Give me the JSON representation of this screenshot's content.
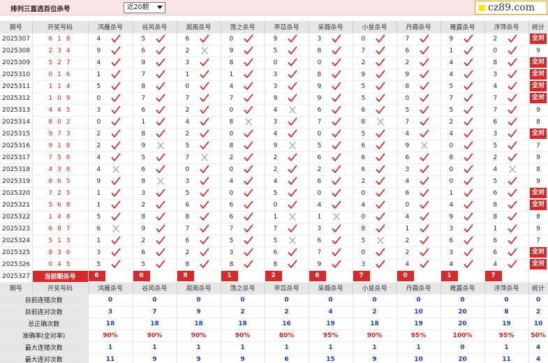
{
  "header": {
    "title": "排列三直选百位杀号",
    "period_selected": "近20期",
    "logo_text": "cz89.com"
  },
  "columns": [
    "期号",
    "开奖号码",
    "鸿雁杀号",
    "谷风杀号",
    "周南杀号",
    "荡之杀号",
    "芣苡杀号",
    "采薇杀号",
    "小旻杀号",
    "丹霞杀号",
    "雍露杀号",
    "浮萍杀号",
    "统计"
  ],
  "rows": [
    {
      "period": "2025307",
      "draw": "618",
      "v": [
        [
          4,
          1
        ],
        [
          5,
          1
        ],
        [
          6,
          1
        ],
        [
          0,
          1
        ],
        [
          9,
          1
        ],
        [
          3,
          1
        ],
        [
          0,
          1
        ],
        [
          7,
          1
        ],
        [
          9,
          1
        ],
        [
          2,
          1
        ]
      ],
      "stat": "全对"
    },
    {
      "period": "2025308",
      "draw": "234",
      "v": [
        [
          9,
          1
        ],
        [
          6,
          1
        ],
        [
          2,
          0
        ],
        [
          9,
          1
        ],
        [
          5,
          1
        ],
        [
          8,
          1
        ],
        [
          7,
          1
        ],
        [
          6,
          1
        ],
        [
          1,
          1
        ],
        [
          0,
          1
        ]
      ],
      "stat": "9"
    },
    {
      "period": "2025309",
      "draw": "527",
      "v": [
        [
          4,
          1
        ],
        [
          9,
          1
        ],
        [
          3,
          1
        ],
        [
          8,
          1
        ],
        [
          0,
          1
        ],
        [
          0,
          1
        ],
        [
          2,
          1
        ],
        [
          2,
          1
        ],
        [
          4,
          1
        ],
        [
          8,
          1
        ]
      ],
      "stat": "全对"
    },
    {
      "period": "2025310",
      "draw": "016",
      "v": [
        [
          1,
          1
        ],
        [
          7,
          1
        ],
        [
          1,
          1
        ],
        [
          1,
          1
        ],
        [
          3,
          1
        ],
        [
          8,
          1
        ],
        [
          9,
          1
        ],
        [
          9,
          1
        ],
        [
          4,
          1
        ],
        [
          3,
          1
        ]
      ],
      "stat": "全对"
    },
    {
      "period": "2025311",
      "draw": "114",
      "v": [
        [
          5,
          1
        ],
        [
          8,
          1
        ],
        [
          0,
          1
        ],
        [
          4,
          1
        ],
        [
          3,
          1
        ],
        [
          9,
          1
        ],
        [
          5,
          1
        ],
        [
          8,
          1
        ],
        [
          5,
          1
        ],
        [
          4,
          1
        ]
      ],
      "stat": "全对"
    },
    {
      "period": "2025312",
      "draw": "109",
      "v": [
        [
          0,
          1
        ],
        [
          7,
          1
        ],
        [
          7,
          1
        ],
        [
          7,
          1
        ],
        [
          9,
          1
        ],
        [
          9,
          1
        ],
        [
          5,
          1
        ],
        [
          0,
          1
        ],
        [
          7,
          1
        ],
        [
          7,
          1
        ]
      ],
      "stat": "全对"
    },
    {
      "period": "2025313",
      "draw": "445",
      "v": [
        [
          3,
          1
        ],
        [
          6,
          1
        ],
        [
          2,
          1
        ],
        [
          0,
          1
        ],
        [
          4,
          0
        ],
        [
          6,
          1
        ],
        [
          6,
          1
        ],
        [
          5,
          1
        ],
        [
          5,
          1
        ],
        [
          7,
          1
        ]
      ],
      "stat": "9"
    },
    {
      "period": "2025314",
      "draw": "802",
      "v": [
        [
          0,
          1
        ],
        [
          1,
          1
        ],
        [
          4,
          1
        ],
        [
          8,
          0
        ],
        [
          3,
          1
        ],
        [
          7,
          1
        ],
        [
          8,
          0
        ],
        [
          7,
          1
        ],
        [
          2,
          1
        ],
        [
          6,
          1
        ]
      ],
      "stat": "8"
    },
    {
      "period": "2025315",
      "draw": "973",
      "v": [
        [
          2,
          1
        ],
        [
          8,
          1
        ],
        [
          2,
          1
        ],
        [
          0,
          1
        ],
        [
          4,
          1
        ],
        [
          0,
          1
        ],
        [
          5,
          1
        ],
        [
          4,
          1
        ],
        [
          4,
          1
        ],
        [
          3,
          1
        ]
      ],
      "stat": "全对"
    },
    {
      "period": "2025316",
      "draw": "918",
      "v": [
        [
          2,
          1
        ],
        [
          9,
          0
        ],
        [
          5,
          1
        ],
        [
          8,
          1
        ],
        [
          9,
          0
        ],
        [
          5,
          1
        ],
        [
          6,
          1
        ],
        [
          9,
          0
        ],
        [
          0,
          1
        ],
        [
          5,
          1
        ]
      ],
      "stat": "7"
    },
    {
      "period": "2025317",
      "draw": "756",
      "v": [
        [
          4,
          1
        ],
        [
          5,
          1
        ],
        [
          7,
          0
        ],
        [
          2,
          1
        ],
        [
          2,
          1
        ],
        [
          6,
          1
        ],
        [
          6,
          1
        ],
        [
          6,
          1
        ],
        [
          8,
          1
        ],
        [
          2,
          1
        ]
      ],
      "stat": "9"
    },
    {
      "period": "2025318",
      "draw": "438",
      "v": [
        [
          4,
          0
        ],
        [
          6,
          1
        ],
        [
          0,
          1
        ],
        [
          0,
          1
        ],
        [
          2,
          1
        ],
        [
          2,
          1
        ],
        [
          6,
          1
        ],
        [
          3,
          1
        ],
        [
          0,
          1
        ],
        [
          4,
          0
        ]
      ],
      "stat": "8"
    },
    {
      "period": "2025319",
      "draw": "865",
      "v": [
        [
          9,
          1
        ],
        [
          8,
          0
        ],
        [
          3,
          1
        ],
        [
          4,
          1
        ],
        [
          4,
          1
        ],
        [
          6,
          1
        ],
        [
          2,
          1
        ],
        [
          4,
          1
        ],
        [
          0,
          1
        ],
        [
          5,
          1
        ]
      ],
      "stat": "9"
    },
    {
      "period": "2025320",
      "draw": "725",
      "v": [
        [
          1,
          1
        ],
        [
          3,
          1
        ],
        [
          5,
          1
        ],
        [
          0,
          1
        ],
        [
          5,
          1
        ],
        [
          0,
          1
        ],
        [
          0,
          1
        ],
        [
          6,
          1
        ],
        [
          1,
          1
        ],
        [
          6,
          1
        ]
      ],
      "stat": "全对"
    },
    {
      "period": "2025321",
      "draw": "568",
      "v": [
        [
          1,
          1
        ],
        [
          2,
          1
        ],
        [
          6,
          1
        ],
        [
          6,
          1
        ],
        [
          0,
          1
        ],
        [
          4,
          1
        ],
        [
          4,
          1
        ],
        [
          0,
          1
        ],
        [
          4,
          1
        ],
        [
          8,
          1
        ]
      ],
      "stat": "全对"
    },
    {
      "period": "2025322",
      "draw": "148",
      "v": [
        [
          5,
          1
        ],
        [
          8,
          1
        ],
        [
          8,
          1
        ],
        [
          6,
          1
        ],
        [
          1,
          0
        ],
        [
          1,
          0
        ],
        [
          0,
          1
        ],
        [
          4,
          1
        ],
        [
          9,
          1
        ],
        [
          8,
          1
        ]
      ],
      "stat": "8"
    },
    {
      "period": "2025323",
      "draw": "687",
      "v": [
        [
          6,
          0
        ],
        [
          9,
          1
        ],
        [
          7,
          1
        ],
        [
          7,
          1
        ],
        [
          7,
          1
        ],
        [
          3,
          1
        ],
        [
          8,
          1
        ],
        [
          1,
          1
        ],
        [
          3,
          1
        ],
        [
          1,
          1
        ]
      ],
      "stat": "9"
    },
    {
      "period": "2025324",
      "draw": "513",
      "v": [
        [
          1,
          1
        ],
        [
          2,
          1
        ],
        [
          6,
          1
        ],
        [
          5,
          1
        ],
        [
          5,
          0
        ],
        [
          6,
          1
        ],
        [
          5,
          0
        ],
        [
          2,
          1
        ],
        [
          6,
          1
        ],
        [
          6,
          1
        ]
      ],
      "stat": "7"
    },
    {
      "period": "2025325",
      "draw": "836",
      "v": [
        [
          3,
          1
        ],
        [
          6,
          1
        ],
        [
          2,
          1
        ],
        [
          3,
          1
        ],
        [
          6,
          1
        ],
        [
          7,
          1
        ],
        [
          0,
          1
        ],
        [
          2,
          1
        ],
        [
          3,
          1
        ],
        [
          6,
          1
        ]
      ],
      "stat": "全对"
    },
    {
      "period": "2025326",
      "draw": "045",
      "v": [
        [
          5,
          1
        ],
        [
          5,
          1
        ],
        [
          8,
          1
        ],
        [
          8,
          1
        ],
        [
          8,
          1
        ],
        [
          9,
          1
        ],
        [
          3,
          1
        ],
        [
          4,
          1
        ],
        [
          4,
          1
        ],
        [
          4,
          1
        ]
      ],
      "stat": "全对"
    }
  ],
  "current": {
    "period": "2025327",
    "label": "当前期杀号",
    "values": [
      "6",
      "0",
      "8",
      "1",
      "2",
      "6",
      "7",
      "0",
      "1",
      "7"
    ]
  },
  "summary": [
    {
      "label": "目前连错次数",
      "values": [
        "0",
        "0",
        "0",
        "0",
        "0",
        "0",
        "0",
        "0",
        "0",
        "0",
        "0"
      ],
      "pct": false
    },
    {
      "label": "目前连对次数",
      "values": [
        "3",
        "7",
        "9",
        "2",
        "2",
        "4",
        "2",
        "10",
        "20",
        "8",
        "2"
      ],
      "pct": false
    },
    {
      "label": "总正确次数",
      "values": [
        "18",
        "18",
        "18",
        "18",
        "16",
        "19",
        "18",
        "19",
        "20",
        "19",
        "10"
      ],
      "pct": false
    },
    {
      "label": "准确率(全对率)",
      "values": [
        "90%",
        "90%",
        "90%",
        "90%",
        "80%",
        "95%",
        "90%",
        "95%",
        "100%",
        "95%",
        "50%"
      ],
      "pct": true
    },
    {
      "label": "最大连错次数",
      "values": [
        "1",
        "1",
        "1",
        "1",
        "1",
        "1",
        "1",
        "1",
        "0",
        "1",
        "4"
      ],
      "pct": false
    },
    {
      "label": "最大连对次数",
      "values": [
        "11",
        "9",
        "9",
        "9",
        "6",
        "15",
        "9",
        "10",
        "20",
        "11",
        "4"
      ],
      "pct": false
    }
  ],
  "colors": {
    "accent": "#d42a2a",
    "check": "#d42a2a",
    "cross": "#b0b0b0",
    "summary": "#1a3cc7"
  }
}
